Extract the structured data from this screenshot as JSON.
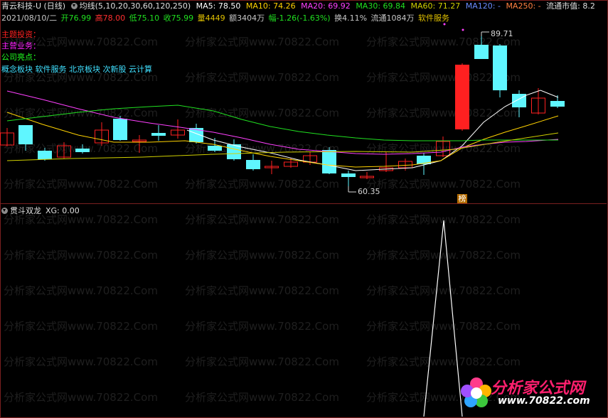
{
  "header": {
    "stock_name": "青云科技-U (日线)",
    "ma_label": "均线(5,10,20,30,60,120,250)",
    "ma": [
      {
        "label": "MA5: 78.50",
        "color": "#ffffff"
      },
      {
        "label": "MA10: 74.26",
        "color": "#ffd200"
      },
      {
        "label": "MA20: 69.92",
        "color": "#ff00ff"
      },
      {
        "label": "MA30: 69.84",
        "color": "#00e000"
      },
      {
        "label": "MA60: 71.27",
        "color": "#d0d000"
      },
      {
        "label": "MA120: -",
        "color": "#6a8cff"
      },
      {
        "label": "MA250: -",
        "color": "#ff8040"
      }
    ],
    "float_cap": "流通市值: 8.2"
  },
  "quote": {
    "date": "2021/08/10/二",
    "open": "开76.99",
    "high": "高78.00",
    "low": "低75.10",
    "close": "收75.99",
    "volume": "量4449",
    "amount": "额3404万",
    "change": "幅-1.26(-1.63%)",
    "turnover": "换4.11%",
    "float_shares": "流通1084万",
    "sector": "软件服务"
  },
  "info_lines": [
    {
      "text": "主题投资：",
      "color": "#ff2020"
    },
    {
      "text": "主营业务：",
      "color": "#ff20ff"
    },
    {
      "text": "公司亮点：",
      "color": "#20ff20"
    },
    {
      "text": "概念板块  软件服务  北京板块  次新股  云计算",
      "color": "#40e0ff"
    }
  ],
  "price_marks": {
    "high": "89.71",
    "low": "60.35"
  },
  "bang_label": "榜",
  "indicator": {
    "name": "贯斗双龙",
    "value": "XG: 0.00"
  },
  "watermark": {
    "site": "www.70822.Com",
    "cn": "分析家公式网"
  },
  "logo": {
    "title": "分析家公式网",
    "url": "www.70822.com"
  },
  "colors": {
    "up": "#ff2020",
    "down": "#5ff6ff",
    "bg": "#000000",
    "frame": "#7a1f1f"
  }
}
